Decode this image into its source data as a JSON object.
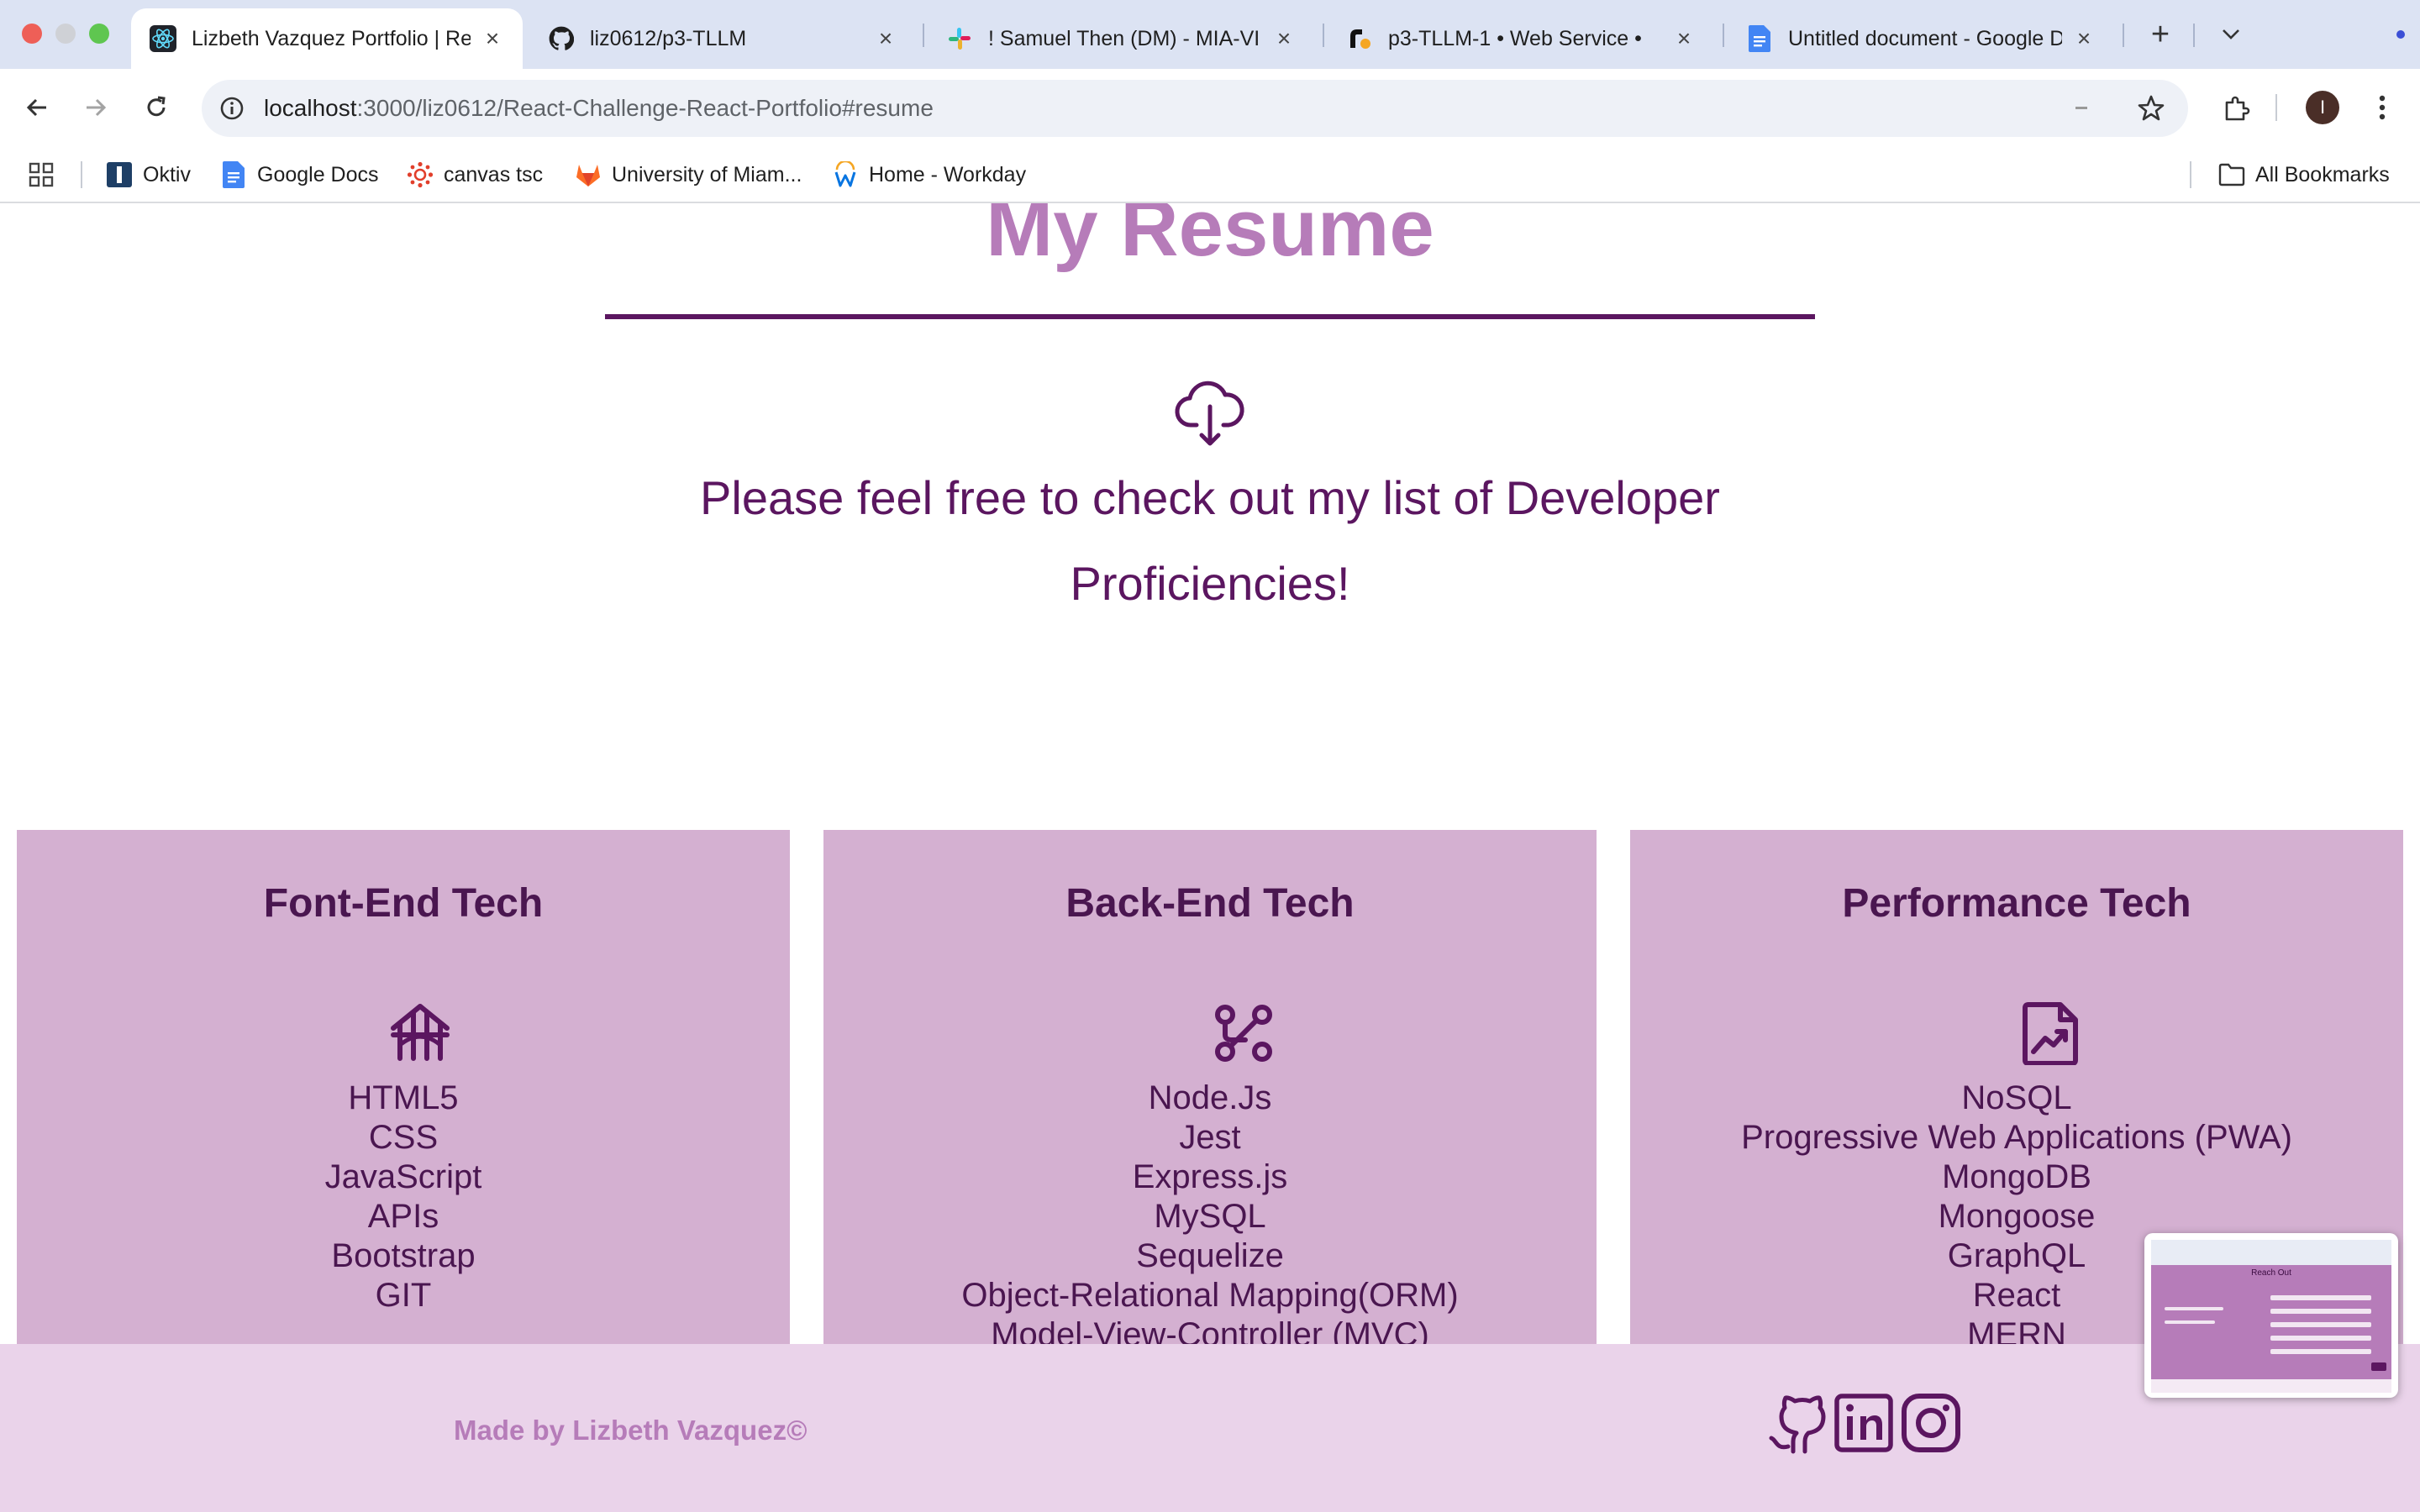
{
  "browser": {
    "tabs": [
      {
        "title": "Lizbeth Vazquez Portfolio | Re",
        "icon": "react-icon",
        "active": true
      },
      {
        "title": "liz0612/p3-TLLM",
        "icon": "github-icon",
        "active": false
      },
      {
        "title": "! Samuel Then (DM) - MIA-VI",
        "icon": "slack-icon",
        "active": false
      },
      {
        "title": "p3-TLLM-1 • Web Service •",
        "icon": "render-icon",
        "active": false
      },
      {
        "title": "Untitled document - Google D",
        "icon": "google-docs-icon",
        "active": false
      }
    ],
    "url_host": "localhost",
    "url_rest": ":3000/liz0612/React-Challenge-React-Portfolio#resume",
    "avatar_letter": "I",
    "bookmarks": [
      {
        "label": "Oktiv",
        "icon": "oktiv-icon"
      },
      {
        "label": "Google Docs",
        "icon": "google-docs-icon"
      },
      {
        "label": "canvas tsc",
        "icon": "canvas-icon"
      },
      {
        "label": "University of Miam...",
        "icon": "gitlab-icon"
      },
      {
        "label": "Home - Workday",
        "icon": "workday-icon"
      }
    ],
    "all_bookmarks": "All Bookmarks"
  },
  "page": {
    "title": "My Resume",
    "intro": "Please feel free to check out my list of Developer Proficiencies!",
    "cards": [
      {
        "heading": "Font-End Tech",
        "icon": "bridge-icon",
        "items": [
          "HTML5",
          "CSS",
          "JavaScript",
          "APIs",
          "Bootstrap",
          "GIT"
        ]
      },
      {
        "heading": "Back-End Tech",
        "icon": "route-icon",
        "items": [
          "Node.Js",
          "Jest",
          "Express.js",
          "MySQL",
          "Sequelize",
          "Object-Relational Mapping(ORM)",
          "Model-View-Controller (MVC)"
        ]
      },
      {
        "heading": "Performance Tech",
        "icon": "chart-file-icon",
        "items": [
          "NoSQL",
          "Progressive Web Applications (PWA)",
          "MongoDB",
          "Mongoose",
          "GraphQL",
          "React",
          "MERN"
        ]
      }
    ],
    "footer": {
      "credit": "Made by Lizbeth Vazquez©",
      "social": [
        "github-icon",
        "linkedin-icon",
        "instagram-icon"
      ]
    },
    "pip_preview": {
      "title": "Reach Out"
    }
  },
  "colors": {
    "title": "#b67cb9",
    "accent": "#5b1660",
    "card": "#d4b0d1",
    "footer": "#ead3ea",
    "tabstrip": "#dce3f3"
  }
}
